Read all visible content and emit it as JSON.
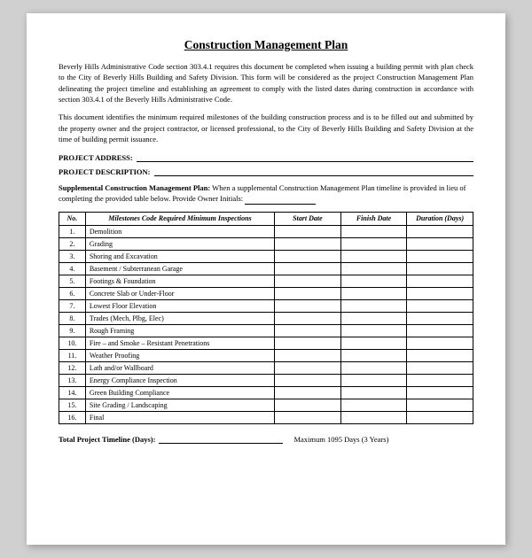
{
  "title": "Construction Management Plan",
  "paragraph1": "Beverly Hills Administrative Code section 303.4.1 requires this document be completed when issuing a building permit with plan check to the City of Beverly Hills Building and Safety Division.  This form will be considered as the project Construction Management Plan delineating the project timeline and establishing an agreement to comply with the listed dates during construction in accordance with section 303.4.1 of the Beverly Hills Administrative Code.",
  "paragraph2": "This document identifies the minimum required milestones of the building construction process and is to be filled out and submitted by the property owner and the project contractor, or licensed professional, to the City of Beverly Hills Building and Safety Division at the time of building permit issuance.",
  "fields": {
    "project_address_label": "PROJECT ADDRESS:",
    "project_description_label": "PROJECT DESCRIPTION:"
  },
  "supplemental": {
    "text": "Supplemental Construction Management Plan: When a supplemental Construction Management Plan timeline is provided in lieu of completing the provided table below. Provide Owner Initials: "
  },
  "table": {
    "headers": {
      "no": "No.",
      "milestones": "Milestones Code Required Minimum Inspections",
      "start_date": "Start Date",
      "finish_date": "Finish Date",
      "duration": "Duration (Days)"
    },
    "rows": [
      {
        "no": "1.",
        "milestone": "Demolition"
      },
      {
        "no": "2.",
        "milestone": "Grading"
      },
      {
        "no": "3.",
        "milestone": "Shoring and Excavation"
      },
      {
        "no": "4.",
        "milestone": "Basement / Subterranean Garage"
      },
      {
        "no": "5.",
        "milestone": "Footings & Foundation"
      },
      {
        "no": "6.",
        "milestone": "Concrete Slab or Under-Floor"
      },
      {
        "no": "7.",
        "milestone": "Lowest Floor Elevation"
      },
      {
        "no": "8.",
        "milestone": "Trades (Mech, Plbg, Elec)"
      },
      {
        "no": "9.",
        "milestone": "Rough Framing"
      },
      {
        "no": "10.",
        "milestone": "Fire – and Smoke – Resistant Penetrations"
      },
      {
        "no": "11.",
        "milestone": "Weather Proofing"
      },
      {
        "no": "12.",
        "milestone": "Lath and/or Wallboard"
      },
      {
        "no": "13.",
        "milestone": "Energy Compliance Inspection"
      },
      {
        "no": "14.",
        "milestone": "Green Building Compliance"
      },
      {
        "no": "15.",
        "milestone": "Site Grading / Landscaping"
      },
      {
        "no": "16.",
        "milestone": "Final"
      }
    ]
  },
  "total_line": {
    "label": "Total Project Timeline (Days):",
    "max_text": "Maximum 1095 Days (3 Years)"
  }
}
